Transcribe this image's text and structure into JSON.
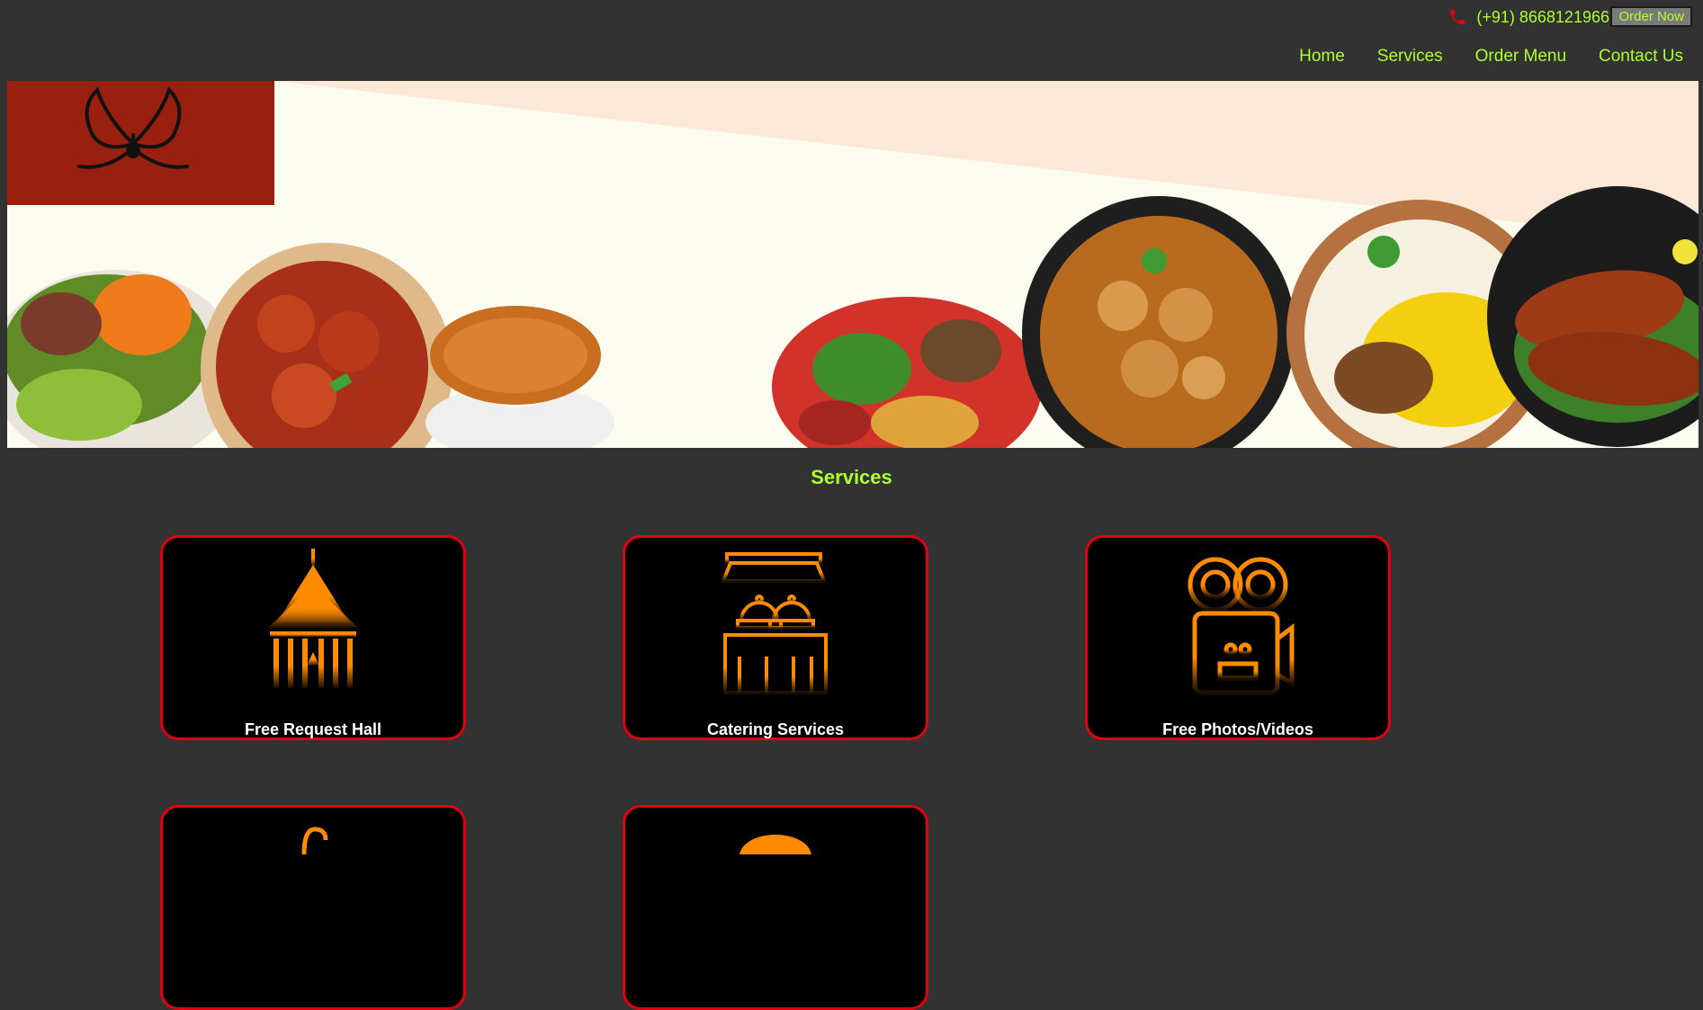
{
  "header": {
    "phone": "(+91) 8668121966",
    "order_button": "Order Now",
    "nav": [
      "Home",
      "Services",
      "Order Menu",
      "Contact Us"
    ]
  },
  "hero": {
    "logo_icon": "butterfly-logo-icon",
    "dishes": [
      "salad",
      "chilli-chicken",
      "soup",
      "chilli-vegetables",
      "chicken-curry",
      "biryani",
      "fried-fish"
    ]
  },
  "services": {
    "title": "Services",
    "items": [
      {
        "label": "Free Request Hall",
        "icon": "hall-icon"
      },
      {
        "label": "Catering Services",
        "icon": "catering-icon"
      },
      {
        "label": "Free Photos/Videos",
        "icon": "video-camera-icon"
      },
      {
        "label": "",
        "icon": "partial-icon-4"
      },
      {
        "label": "",
        "icon": "partial-icon-5"
      }
    ]
  },
  "colors": {
    "background": "#323232",
    "accent": "#adff2f",
    "card_border": "#e3000f",
    "icon": "#ff8c00",
    "logo_bg": "#99200f"
  }
}
